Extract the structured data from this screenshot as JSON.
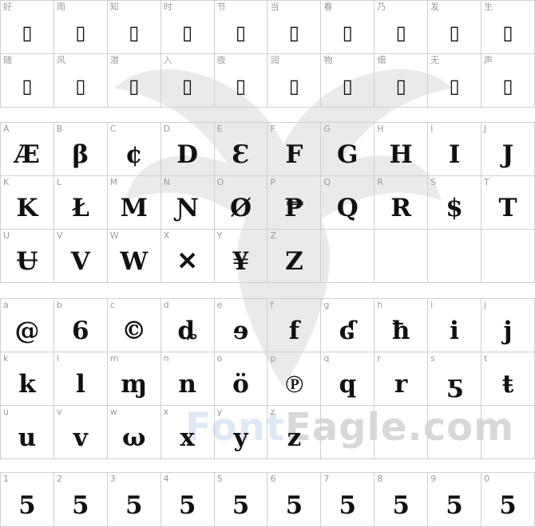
{
  "watermark": {
    "text_part1": "Font",
    "text_part2": "Eagle.com"
  },
  "groups": [
    {
      "id": "chinese",
      "rows": [
        [
          {
            "label": "好",
            "glyph": "▯"
          },
          {
            "label": "雨",
            "glyph": "▯"
          },
          {
            "label": "知",
            "glyph": "▯"
          },
          {
            "label": "时",
            "glyph": "▯"
          },
          {
            "label": "节",
            "glyph": "▯"
          },
          {
            "label": "当",
            "glyph": "▯"
          },
          {
            "label": "春",
            "glyph": "▯"
          },
          {
            "label": "乃",
            "glyph": "▯"
          },
          {
            "label": "发",
            "glyph": "▯"
          },
          {
            "label": "生",
            "glyph": "▯"
          }
        ],
        [
          {
            "label": "随",
            "glyph": "▯"
          },
          {
            "label": "风",
            "glyph": "▯"
          },
          {
            "label": "潜",
            "glyph": "▯"
          },
          {
            "label": "入",
            "glyph": "▯"
          },
          {
            "label": "夜",
            "glyph": "▯"
          },
          {
            "label": "润",
            "glyph": "▯"
          },
          {
            "label": "物",
            "glyph": "▯"
          },
          {
            "label": "细",
            "glyph": "▯"
          },
          {
            "label": "无",
            "glyph": "▯"
          },
          {
            "label": "声",
            "glyph": "▯"
          }
        ]
      ]
    },
    {
      "id": "uppercase",
      "rows": [
        [
          {
            "label": "A",
            "glyph": "Æ"
          },
          {
            "label": "B",
            "glyph": "β"
          },
          {
            "label": "C",
            "glyph": "¢"
          },
          {
            "label": "D",
            "glyph": "D"
          },
          {
            "label": "E",
            "glyph": "Ɛ"
          },
          {
            "label": "F",
            "glyph": "F"
          },
          {
            "label": "G",
            "glyph": "G"
          },
          {
            "label": "H",
            "glyph": "H"
          },
          {
            "label": "I",
            "glyph": "I"
          },
          {
            "label": "J",
            "glyph": "J"
          }
        ],
        [
          {
            "label": "K",
            "glyph": "K"
          },
          {
            "label": "L",
            "glyph": "Ł"
          },
          {
            "label": "M",
            "glyph": "M"
          },
          {
            "label": "N",
            "glyph": "Ɲ"
          },
          {
            "label": "O",
            "glyph": "Ø"
          },
          {
            "label": "P",
            "glyph": "₱"
          },
          {
            "label": "Q",
            "glyph": "Q"
          },
          {
            "label": "R",
            "glyph": "R"
          },
          {
            "label": "S",
            "glyph": "$"
          },
          {
            "label": "T",
            "glyph": "T"
          }
        ],
        [
          {
            "label": "U",
            "glyph": "Ʉ"
          },
          {
            "label": "V",
            "glyph": "V"
          },
          {
            "label": "W",
            "glyph": "W"
          },
          {
            "label": "X",
            "glyph": "✕"
          },
          {
            "label": "Y",
            "glyph": "¥"
          },
          {
            "label": "Z",
            "glyph": "Z"
          },
          {
            "label": "",
            "glyph": ""
          },
          {
            "label": "",
            "glyph": ""
          },
          {
            "label": "",
            "glyph": ""
          },
          {
            "label": "",
            "glyph": ""
          }
        ]
      ]
    },
    {
      "id": "lowercase",
      "rows": [
        [
          {
            "label": "a",
            "glyph": "@"
          },
          {
            "label": "b",
            "glyph": "6"
          },
          {
            "label": "c",
            "glyph": "©"
          },
          {
            "label": "d",
            "glyph": "ȡ"
          },
          {
            "label": "e",
            "glyph": "ɘ"
          },
          {
            "label": "f",
            "glyph": "f"
          },
          {
            "label": "g",
            "glyph": "ʛ"
          },
          {
            "label": "h",
            "glyph": "ħ"
          },
          {
            "label": "i",
            "glyph": "i"
          },
          {
            "label": "j",
            "glyph": "j"
          }
        ],
        [
          {
            "label": "k",
            "glyph": "k"
          },
          {
            "label": "l",
            "glyph": "l"
          },
          {
            "label": "m",
            "glyph": "ɱ"
          },
          {
            "label": "n",
            "glyph": "n"
          },
          {
            "label": "o",
            "glyph": "ö"
          },
          {
            "label": "p",
            "glyph": "℗"
          },
          {
            "label": "q",
            "glyph": "q"
          },
          {
            "label": "r",
            "glyph": "r"
          },
          {
            "label": "s",
            "glyph": "ƽ"
          },
          {
            "label": "t",
            "glyph": "ŧ"
          }
        ],
        [
          {
            "label": "u",
            "glyph": "u"
          },
          {
            "label": "v",
            "glyph": "v"
          },
          {
            "label": "w",
            "glyph": "ω"
          },
          {
            "label": "x",
            "glyph": "x"
          },
          {
            "label": "y",
            "glyph": "y"
          },
          {
            "label": "z",
            "glyph": "z"
          },
          {
            "label": "",
            "glyph": ""
          },
          {
            "label": "",
            "glyph": ""
          },
          {
            "label": "",
            "glyph": ""
          },
          {
            "label": "",
            "glyph": ""
          }
        ]
      ]
    },
    {
      "id": "digits",
      "rows": [
        [
          {
            "label": "1",
            "glyph": "5"
          },
          {
            "label": "2",
            "glyph": "5"
          },
          {
            "label": "3",
            "glyph": "5"
          },
          {
            "label": "4",
            "glyph": "5"
          },
          {
            "label": "5",
            "glyph": "5"
          },
          {
            "label": "6",
            "glyph": "5"
          },
          {
            "label": "7",
            "glyph": "5"
          },
          {
            "label": "8",
            "glyph": "5"
          },
          {
            "label": "9",
            "glyph": "5"
          },
          {
            "label": "0",
            "glyph": "5"
          }
        ]
      ]
    }
  ]
}
